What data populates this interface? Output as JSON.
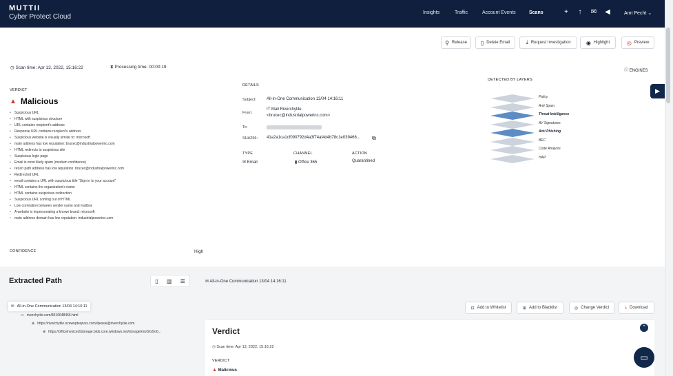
{
  "brand": {
    "name": "MUTTII",
    "subtitle": "Cyber Protect Cloud"
  },
  "nav": [
    {
      "label": "Insights",
      "icon": ""
    },
    {
      "label": "Traffic",
      "icon": ""
    },
    {
      "label": "Account Events",
      "icon": ""
    },
    {
      "label": "Scans",
      "icon": ""
    }
  ],
  "top_icons": {
    "add": "+",
    "upload": "↑",
    "message": "✉",
    "megaphone": "◀"
  },
  "user": {
    "name": "Amt Pecht",
    "caret": "⌄"
  },
  "actions": {
    "release": "Release",
    "delete_email": "Delete Email",
    "request_investigation": "Request Investigation",
    "highlight": "Highlight",
    "preview": "Preview"
  },
  "scan": {
    "time_label": "Scan time: Apr 13, 2022, 15:16:22",
    "processing_label": "Processing time: 00:00:19",
    "engines_label": "ENGINES"
  },
  "verdict": {
    "heading": "VERDICT",
    "value": "Malicious",
    "reasons": [
      "Suspicious URL",
      "HTML with suspicious structure",
      "URL contains recipient's address",
      "Response URL contains recipient's address",
      "Suspicious website is visually similar to: microsoft",
      "main address has low reputation: brucec@industrialpowerinc.com",
      "HTML redirects to suspicious site",
      "Suspicious login page",
      "Email is most likely spam (medium confidence)",
      "return path address has low reputation: brucec@industrialpowerinc.com",
      "Redirected URL",
      "email contains a URL with suspicious title \"Sign in to your account\"",
      "HTML contains the organization's name",
      "HTML contains suspicious redirection",
      "Suspicious URL coming out of HTML",
      "Low correlation between sender name and mailbox",
      "A website is impersonating a known brand: microsoft",
      "main address domain has low reputation: industrialpowerinc.com"
    ],
    "confidence_label": "CONFIDENCE",
    "confidence_value": "High"
  },
  "details": {
    "heading": "DETAILS",
    "subject_label": "Subject:",
    "subject_value": "All-in-One Communication 13/04 14:16:11",
    "from_label": "From:",
    "from_name": "IT Mail Riverchytile",
    "from_email": "<brucec@industrialpowerinc.com>",
    "to_label": "To:",
    "sha_label": "SHA256:",
    "sha_value": "41a2a1ca1cf090792d4a3f74af4d4b78c1e039466...",
    "type_label": "TYPE",
    "type_value": "Email",
    "channel_label": "CHANNEL",
    "channel_value": "Office 365",
    "action_label": "ACTION",
    "action_value": "Quarantined"
  },
  "layers": {
    "heading": "DETECTED BY LAYERS",
    "items": [
      {
        "label": "Policy",
        "detected": false
      },
      {
        "label": "Anti Spam",
        "detected": false
      },
      {
        "label": "Threat Intelligence",
        "detected": true
      },
      {
        "label": "AV Signatures",
        "detected": false
      },
      {
        "label": "Anti Phishing",
        "detected": true
      },
      {
        "label": "BEC",
        "detected": false
      },
      {
        "label": "Code Analysis",
        "detected": false
      },
      {
        "label": "HAP",
        "detected": false
      }
    ],
    "colors": {
      "detected": "#4a7fc0",
      "normal": "#c8ced8"
    }
  },
  "extracted": {
    "title": "Extracted Path",
    "header_item": "All-in-One Communication 13/04 14:16:11",
    "root": "All-in-One Communication 13/04 14:16:11",
    "child1": "riverchytile.com/8416648466.html",
    "child2": "https://riverchytile.ocewnpteqrvss.com/#jessie@riverchytile.com",
    "child3": "https://officeinvoices5storage.blob.core.windows.net/storage/m/v3/o3/o0...",
    "buttons": {
      "whitelist": "Add to Whitelist",
      "blacklist": "Add to Blacklist",
      "change_verdict": "Change Verdict",
      "download": "Download"
    }
  },
  "card": {
    "title": "Verdict",
    "scan_time": "Scan time: Apr 13, 2022, 15:16:22",
    "verdict_label": "VERDICT",
    "verdict_value": "Malicious"
  },
  "colors": {
    "navy": "#0f1f3d",
    "danger": "#d33a2c",
    "accent": "#183058"
  }
}
